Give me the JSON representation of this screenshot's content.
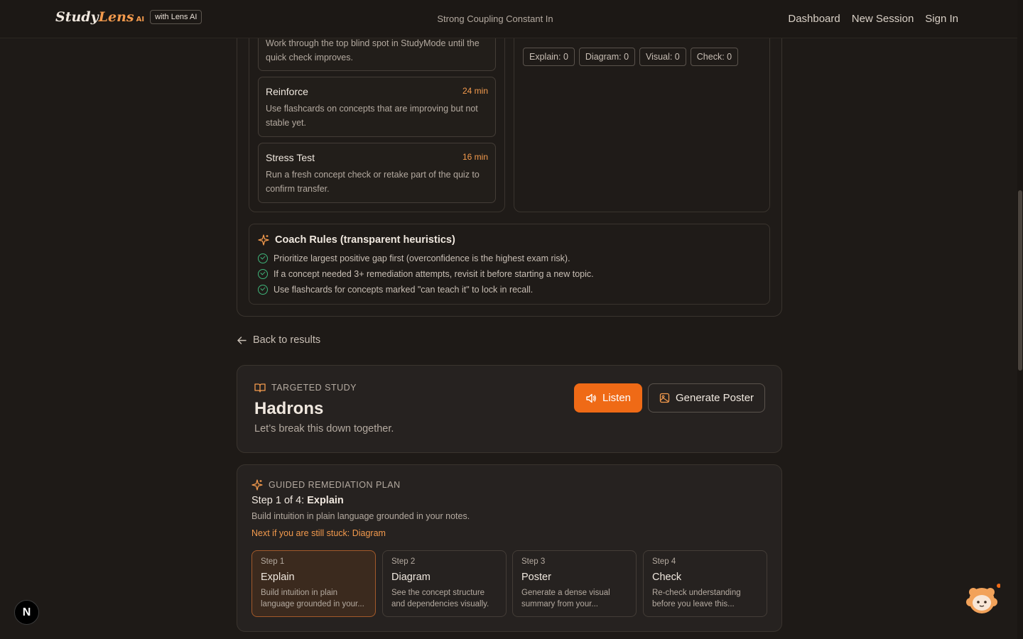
{
  "nav": {
    "logo_study": "Study",
    "logo_lens": "Lens",
    "logo_ai": "AI",
    "chip": "with Lens AI",
    "title": "Strong Coupling Constant In",
    "links": [
      "Dashboard",
      "New Session",
      "Sign In"
    ]
  },
  "plan": {
    "first_desc": "Work through the top blind spot in StudyMode until the quick check improves.",
    "steps": [
      {
        "title": "Reinforce",
        "minutes": "24 min",
        "desc": "Use flashcards on concepts that are improving but not stable yet."
      },
      {
        "title": "Stress Test",
        "minutes": "16 min",
        "desc": "Run a fresh concept check or retake part of the quiz to confirm transfer."
      }
    ],
    "chips": [
      "Explain: 0",
      "Diagram: 0",
      "Visual: 0",
      "Check: 0"
    ]
  },
  "coach": {
    "title": "Coach Rules (transparent heuristics)",
    "rules": [
      "Prioritize largest positive gap first (overconfidence is the highest exam risk).",
      "If a concept needed 3+ remediation attempts, revisit it before starting a new topic.",
      "Use flashcards for concepts marked \"can teach it\" to lock in recall."
    ]
  },
  "back_label": "Back to results",
  "targeted": {
    "label": "TARGETED STUDY",
    "title": "Hadrons",
    "subtitle": "Let’s break this down together.",
    "listen": "Listen",
    "poster": "Generate Poster"
  },
  "remediation": {
    "label": "GUIDED REMEDIATION PLAN",
    "step_prefix": "Step 1 of 4: ",
    "step_name": "Explain",
    "desc": "Build intuition in plain language grounded in your notes.",
    "next": "Next if you are still stuck: Diagram",
    "steps": [
      {
        "num": "Step 1",
        "name": "Explain",
        "desc": "Build intuition in plain language grounded in your..."
      },
      {
        "num": "Step 2",
        "name": "Diagram",
        "desc": "See the concept structure and dependencies visually."
      },
      {
        "num": "Step 3",
        "name": "Poster",
        "desc": "Generate a dense visual summary from your..."
      },
      {
        "num": "Step 4",
        "name": "Check",
        "desc": "Re-check understanding before you leave this..."
      }
    ]
  },
  "badge": "N",
  "colors": {
    "accent": "#ef6a16",
    "accent_text": "#f39a4d",
    "check": "#3fb57a",
    "bg": "#1e1a17"
  }
}
